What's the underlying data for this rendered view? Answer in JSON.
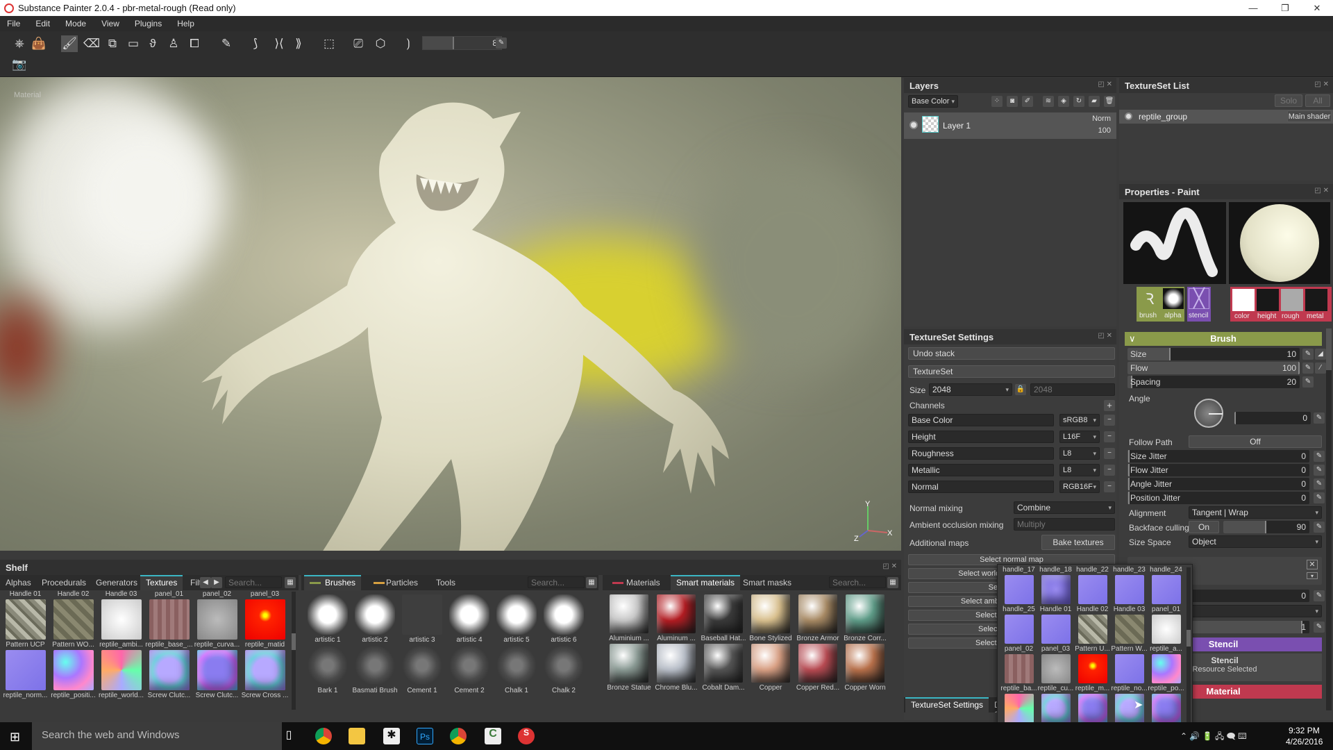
{
  "window": {
    "title": "Substance Painter 2.0.4 - pbr-metal-rough (Read only)",
    "controls": [
      "—",
      "❐",
      "✕"
    ]
  },
  "menu": [
    "File",
    "Edit",
    "Mode",
    "View",
    "Plugins",
    "Help"
  ],
  "toolbar": {
    "brush_size_value": "8"
  },
  "viewport": {
    "label": "Material",
    "axis": {
      "x": "X",
      "y": "Y",
      "z": "Z"
    }
  },
  "layers": {
    "title": "Layers",
    "channel_select": "Base Color",
    "items": [
      {
        "name": "Layer 1",
        "blend": "Norm",
        "opacity": "100"
      }
    ]
  },
  "textureset_list": {
    "title": "TextureSet List",
    "solo": "Solo",
    "all": "All",
    "items": [
      {
        "name": "reptile_group",
        "shader": "Main shader"
      }
    ]
  },
  "textureset_settings": {
    "title": "TextureSet Settings",
    "undo_stack": "Undo stack",
    "textureset": "TextureSet",
    "size_label": "Size",
    "size_value": "2048",
    "size_value2": "2048",
    "channels_label": "Channels",
    "channels": [
      {
        "name": "Base Color",
        "format": "sRGB8"
      },
      {
        "name": "Height",
        "format": "L16F"
      },
      {
        "name": "Roughness",
        "format": "L8"
      },
      {
        "name": "Metallic",
        "format": "L8"
      },
      {
        "name": "Normal",
        "format": "RGB16F"
      }
    ],
    "normal_mixing_label": "Normal mixing",
    "normal_mixing_value": "Combine",
    "ao_mixing_label": "Ambient occlusion mixing",
    "ao_mixing_value": "Multiply",
    "additional_maps_label": "Additional maps",
    "bake_button": "Bake textures",
    "select_buttons": [
      "Select normal map",
      "Select world space normal map",
      "Select id map",
      "Select ambient occlusion map",
      "Select curvature map",
      "Select position map",
      "Select thickness map"
    ],
    "bottom_tabs": [
      "TextureSet Settings",
      "Display Settings"
    ]
  },
  "properties": {
    "title": "Properties - Paint",
    "tool_slots": [
      "brush",
      "alpha",
      "stencil"
    ],
    "material_slots": [
      "color",
      "height",
      "rough",
      "metal"
    ],
    "brush_section": "Brush",
    "sliders": [
      {
        "label": "Size",
        "value": "10",
        "fraction": 0.2
      },
      {
        "label": "Flow",
        "value": "100",
        "fraction": 1.0
      },
      {
        "label": "Spacing",
        "value": "20",
        "fraction": 0.02
      }
    ],
    "angle_label": "Angle",
    "angle_value": "0",
    "follow_path_label": "Follow Path",
    "follow_path_value": "Off",
    "jitters": [
      {
        "label": "Size Jitter",
        "value": "0"
      },
      {
        "label": "Flow Jitter",
        "value": "0"
      },
      {
        "label": "Angle Jitter",
        "value": "0"
      },
      {
        "label": "Position Jitter",
        "value": "0"
      }
    ],
    "alignment_label": "Alignment",
    "alignment_value": "Tangent | Wrap",
    "backface_label": "Backface culling",
    "backface_toggle": "On",
    "backface_value": "90",
    "size_space_label": "Size Space",
    "size_space_value": "Object",
    "alpha_value": "0",
    "alpha_dd_partial": "an",
    "alpha_value2": "1",
    "stencil_section": "Stencil",
    "stencil_title": "Stencil",
    "stencil_sub": "Resource Selected",
    "material_section": "Material"
  },
  "shelf": {
    "title": "Shelf",
    "tabs": [
      "Alphas",
      "Procedurals",
      "Generators",
      "Textures",
      "Filt"
    ],
    "search_placeholder": "Search...",
    "top_labels": [
      "Handle 01",
      "Handle 02",
      "Handle 03",
      "panel_01",
      "panel_02",
      "panel_03"
    ],
    "row1": [
      "Pattern UCP",
      "Pattern WO...",
      "reptile_ambi...",
      "reptile_base_...",
      "reptile_curva...",
      "reptile_matid"
    ],
    "row2": [
      "reptile_norm...",
      "reptile_positi...",
      "reptile_world...",
      "Screw Clutc...",
      "Screw Clutc...",
      "Screw Cross ..."
    ]
  },
  "brushes": {
    "tabs": [
      "Brushes",
      "Particles",
      "Tools"
    ],
    "search_placeholder": "Search...",
    "row1": [
      "artistic 1",
      "artistic 2",
      "artistic 3",
      "artistic 4",
      "artistic 5",
      "artistic 6"
    ],
    "row2": [
      "Bark 1",
      "Basmati Brush",
      "Cement 1",
      "Cement 2",
      "Chalk 1",
      "Chalk 2"
    ]
  },
  "materials": {
    "tabs": [
      "Materials",
      "Smart materials",
      "Smart masks"
    ],
    "search_placeholder": "Search...",
    "row1": [
      "Aluminium ...",
      "Aluminum ...",
      "Baseball Hat...",
      "Bone Stylized",
      "Bronze Armor",
      "Bronze Corr..."
    ],
    "row2": [
      "Bronze Statue",
      "Chrome Blu...",
      "Cobalt Dam...",
      "Copper",
      "Copper Red...",
      "Copper Worn"
    ]
  },
  "popup": {
    "rows": [
      [
        "handle_17",
        "handle_18",
        "handle_22",
        "handle_23",
        "handle_24"
      ],
      [
        "handle_25",
        "Handle 01",
        "Handle 02",
        "Handle 03",
        "panel_01"
      ],
      [
        "panel_02",
        "panel_03",
        "Pattern U...",
        "Pattern W...",
        "reptile_a..."
      ],
      [
        "reptile_ba...",
        "reptile_cu...",
        "reptile_m...",
        "reptile_no...",
        "reptile_po..."
      ]
    ]
  },
  "taskbar": {
    "search": "Search the web and Windows",
    "time": "9:32 PM",
    "date": "4/26/2016"
  },
  "colors": {
    "accent": "#3bb7c5",
    "brush": "#8a9a4a",
    "stencil": "#7a4fb0",
    "material": "#c0394f"
  }
}
